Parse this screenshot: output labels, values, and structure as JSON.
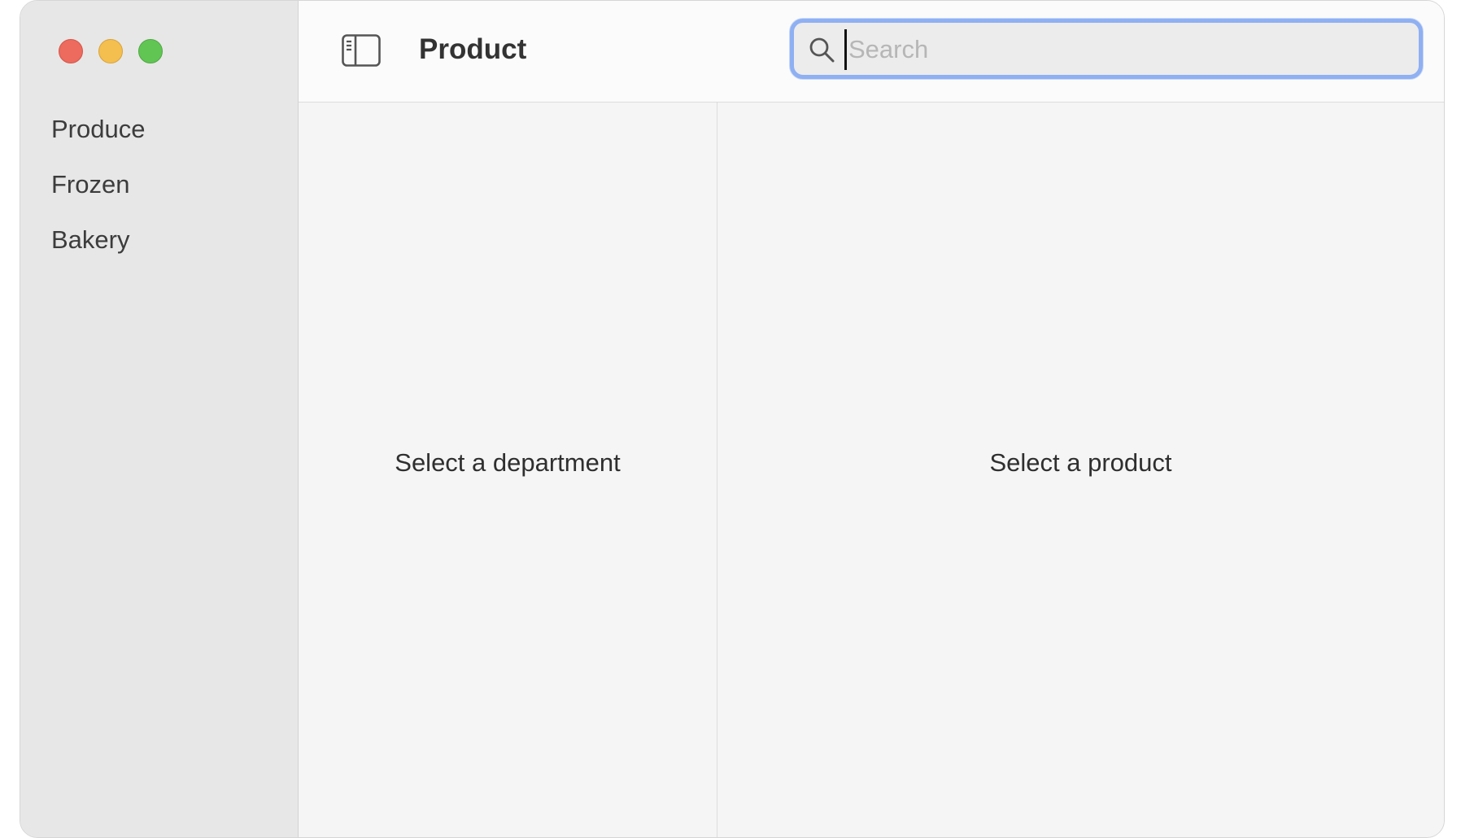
{
  "window": {
    "title": "Product",
    "controls": [
      "close",
      "minimize",
      "zoom"
    ]
  },
  "sidebar": {
    "items": [
      {
        "label": "Produce"
      },
      {
        "label": "Frozen"
      },
      {
        "label": "Bakery"
      }
    ]
  },
  "toolbar": {
    "toggle_icon": "sidebar-toggle-icon",
    "title": "Product",
    "search": {
      "placeholder": "Search",
      "value": "",
      "icon": "magnifying-glass",
      "focused": true,
      "focus_color": "#8fb0f2"
    }
  },
  "content": {
    "department_placeholder": "Select a department",
    "product_placeholder": "Select a product"
  },
  "colors": {
    "close": "#ec6a5e",
    "minimize": "#f4bf4f",
    "zoom": "#61c554"
  }
}
